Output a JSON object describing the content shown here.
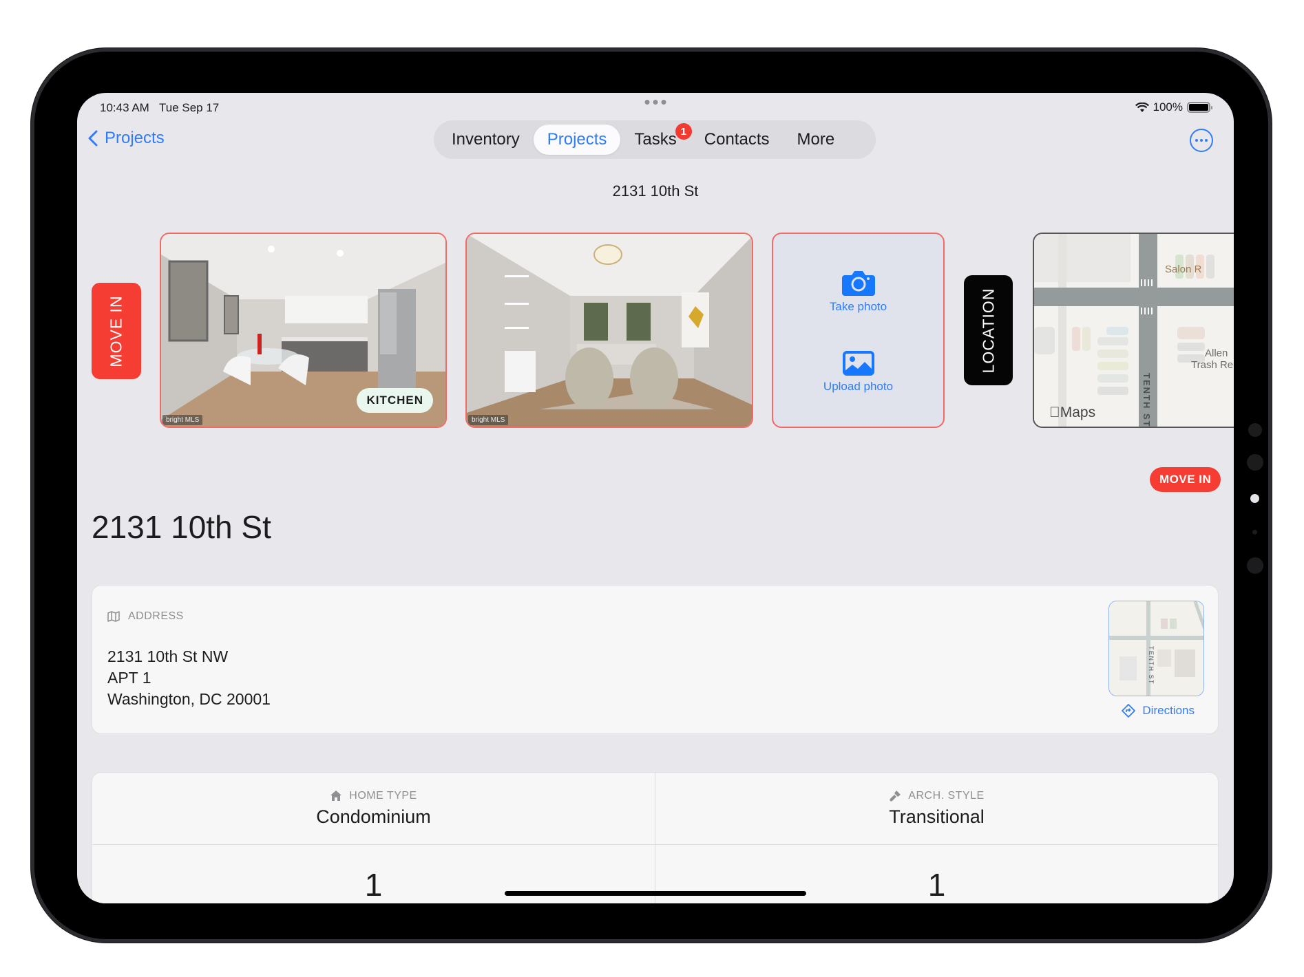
{
  "status_bar": {
    "time": "10:43 AM",
    "date": "Tue Sep 17",
    "battery_text": "100%",
    "battery_level": 1.0,
    "wifi_icon": "wifi-icon"
  },
  "nav": {
    "back_label": "Projects",
    "tabs": [
      {
        "label": "Inventory",
        "active": false
      },
      {
        "label": "Projects",
        "active": true
      },
      {
        "label": "Tasks",
        "active": false,
        "badge": "1"
      },
      {
        "label": "Contacts",
        "active": false
      },
      {
        "label": "More",
        "active": false
      }
    ],
    "more_icon": "ellipsis-circle-icon",
    "subtitle": "2131 10th St"
  },
  "carousel": {
    "section_tab_1": "MOVE IN",
    "photos": [
      {
        "tag": "KITCHEN",
        "watermark": "bright MLS",
        "scene": "kitchen"
      },
      {
        "tag": "",
        "watermark": "bright MLS",
        "scene": "living room"
      }
    ],
    "upload": {
      "take_photo": "Take photo",
      "upload_photo": "Upload photo"
    },
    "section_tab_2": "LOCATION",
    "map": {
      "labels": [
        "Salon R",
        "Allen",
        "Trash Re",
        "TENTH ST"
      ],
      "attribution": "Maps"
    }
  },
  "project": {
    "status_badge": "MOVE IN",
    "title": "2131 10th St",
    "colors": {
      "accent": "#2f7cf6",
      "status": "#f53d33"
    }
  },
  "address": {
    "label": "ADDRESS",
    "line1": "2131 10th St NW",
    "line2": "APT 1",
    "line3": "Washington, DC 20001",
    "map_street_label": "TENTH ST",
    "directions_label": "Directions"
  },
  "details": {
    "home_type_label": "HOME TYPE",
    "home_type_value": "Condominium",
    "arch_style_label": "ARCH. STYLE",
    "arch_style_value": "Transitional",
    "row2_left_value": "1",
    "row2_right_value": "1"
  }
}
